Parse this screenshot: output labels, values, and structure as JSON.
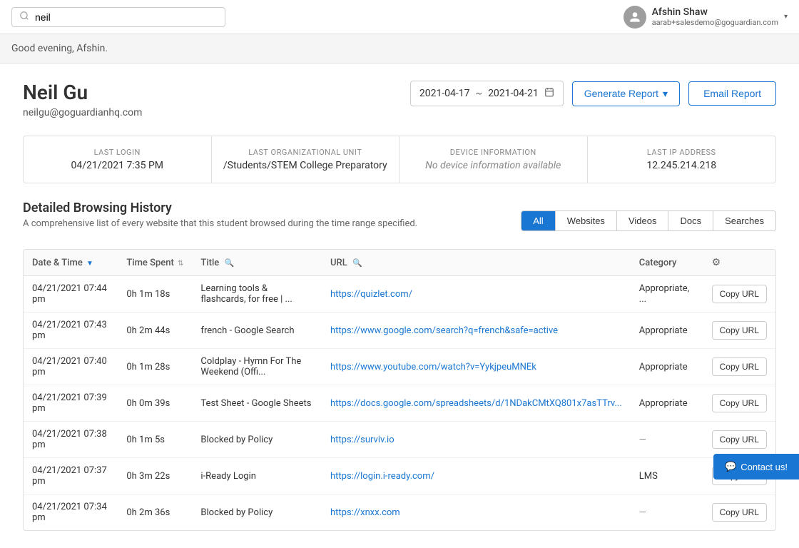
{
  "header": {
    "search_placeholder": "neil",
    "search_value": "neil",
    "user": {
      "name": "Afshin Shaw",
      "email": "aarab+salesdemo@goguardian.com"
    }
  },
  "greeting": "Good evening, Afshin.",
  "student": {
    "name": "Neil Gu",
    "email": "neilgu@goguardianhq.com"
  },
  "date_range": {
    "start": "2021-04-17",
    "separator": "~",
    "end": "2021-04-21"
  },
  "buttons": {
    "generate_report": "Generate Report",
    "email_report": "Email Report"
  },
  "stats": {
    "last_login_label": "LAST LOGIN",
    "last_login_value": "04/21/2021 7:35 PM",
    "last_org_label": "LAST ORGANIZATIONAL UNIT",
    "last_org_value": "/Students/STEM College Preparatory",
    "device_label": "DEVICE INFORMATION",
    "device_value": "No device information available",
    "last_ip_label": "LAST IP ADDRESS",
    "last_ip_value": "12.245.214.218"
  },
  "browsing_history": {
    "title": "Detailed Browsing History",
    "subtitle": "A comprehensive list of every website that this student browsed during the time range specified.",
    "filters": [
      "All",
      "Websites",
      "Videos",
      "Docs",
      "Searches"
    ],
    "active_filter": "All",
    "columns": [
      "Date & Time",
      "Time Spent",
      "Title",
      "URL",
      "Category",
      ""
    ],
    "rows": [
      {
        "date": "04/21/2021 07:44 pm",
        "time_spent": "0h 1m 18s",
        "title": "Learning tools & flashcards, for free | ...",
        "url": "https://quizlet.com/",
        "category": "Appropriate, ...",
        "action": "Copy URL"
      },
      {
        "date": "04/21/2021 07:43 pm",
        "time_spent": "0h 2m 44s",
        "title": "french - Google Search",
        "url": "https://www.google.com/search?q=french&safe=active",
        "category": "Appropriate",
        "action": "Copy URL"
      },
      {
        "date": "04/21/2021 07:40 pm",
        "time_spent": "0h 1m 28s",
        "title": "Coldplay - Hymn For The Weekend (Offi...",
        "url": "https://www.youtube.com/watch?v=YykjpeuMNEk",
        "category": "Appropriate",
        "action": "Copy URL"
      },
      {
        "date": "04/21/2021 07:39 pm",
        "time_spent": "0h 0m 39s",
        "title": "Test Sheet - Google Sheets",
        "url": "https://docs.google.com/spreadsheets/d/1NDakCMtXQ801x7asTTrv...",
        "category": "Appropriate",
        "action": "Copy URL"
      },
      {
        "date": "04/21/2021 07:38 pm",
        "time_spent": "0h 1m 5s",
        "title": "Blocked by Policy",
        "url": "https://surviv.io",
        "category": "—",
        "action": "Copy URL"
      },
      {
        "date": "04/21/2021 07:37 pm",
        "time_spent": "0h 3m 22s",
        "title": "i-Ready Login",
        "url": "https://login.i-ready.com/",
        "category": "LMS",
        "action": "Copy URL"
      },
      {
        "date": "04/21/2021 07:34 pm",
        "time_spent": "0h 2m 36s",
        "title": "Blocked by Policy",
        "url": "https://xnxx.com",
        "category": "—",
        "action": "Copy URL"
      }
    ]
  },
  "contact": {
    "label": "Contact us!"
  }
}
